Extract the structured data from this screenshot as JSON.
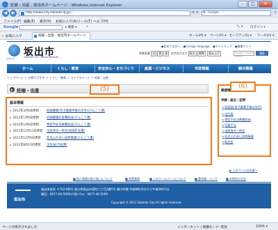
{
  "window": {
    "title": "妊娠・出産 - 坂出市ホームページ - Windows Internet Explorer",
    "minimize": "–",
    "maximize": "□",
    "close": "✕"
  },
  "address": {
    "url": "http://www.city.sakaide.lg.jp/…",
    "search_placeholder": "Google",
    "search_engine": "G"
  },
  "menu": [
    "ファイル(F)",
    "編集(E)",
    "表示(V)",
    "お気に入り(A)",
    "ツール(T)",
    "ヘルプ(H)"
  ],
  "google_toolbar": {
    "logo": "Google",
    "go": "検索",
    "buttons": [
      "▸ 検索 ▾",
      "»",
      "🔧 ▾"
    ],
    "signin": "ログイン ▾"
  },
  "favorites": {
    "label": "お気に入り",
    "item": "妊娠・出産 - 坂出市ホームページ",
    "tools": [
      "ホーム(M) ▾",
      "ページ(P) ▾",
      "セーフティ(S) ▾",
      "ツール(O) ▾"
    ]
  },
  "site": {
    "name": "坂出市",
    "sub": "Sakaide City Official Website",
    "tag": "さかいで",
    "util_links": [
      "●初めての方へ",
      "●Foreign language",
      "●サイトマップ",
      "●携帯サイト"
    ],
    "util_row2_label": "背景変更",
    "util_row2_buttons": [
      "白",
      "黒",
      "青"
    ],
    "text_size_label": "文字の大きさ",
    "text_size_buttons": [
      "拡大",
      "標準"
    ],
    "read_label": "読み上げ",
    "search_placeholder": "Google Custom Search",
    "search_button": "検索",
    "gnav": [
      "ホーム",
      "くらし・教育",
      "安全安心・まちづくり",
      "産業・ビジネス",
      "市政情報",
      "観光情報"
    ],
    "breadcrumb": "トップページ ＞ 分野でさがす ＞ くらし・教育 ＞ ライフステージ ＞ 妊娠・出産",
    "page_title": "妊娠・出産"
  },
  "annotations": {
    "box5": "(5)",
    "box6": "(6)"
  },
  "info": {
    "heading": "基本情報",
    "rows": [
      {
        "date": "2012年3月6日更新",
        "link": "妊婦健康(母子健康手帳の交付)",
        "dept": "(けんこう課)"
      },
      {
        "date": "2012年1月6日更新",
        "link": "妊婦健康診査費助成",
        "dept": "(けんこう課)"
      },
      {
        "date": "2012年1月6日更新",
        "link": "特定不妊治療費助成",
        "dept": "(けんこう課)"
      },
      {
        "date": "2011年12月13日更新",
        "link": "出産育児一時金",
        "dept": "(保険年金課)"
      },
      {
        "date": "2011年12月6日更新",
        "link": "乳児ふれあい訪問事業",
        "dept": "(けんこう課)"
      },
      {
        "date": "2011年8月10日更新",
        "link": "出生届",
        "dept": "(市民課)"
      }
    ]
  },
  "side": {
    "heading": "関連情報",
    "category": "申請・届出・証明",
    "items": [
      "妊娠届(母子健康手帳の交付)",
      "出生届",
      "特定不妊治療費助成",
      "児童手当",
      "出産育児一時金",
      "乳児ふれあい訪問事業",
      "助成金"
    ],
    "more": "▶ このページの先頭へ"
  },
  "footer": {
    "links": [
      "■ 個人情報の取り扱いについて",
      "■ 免責事項",
      "■ このホームページについて",
      "■ 著作権・リンク",
      "■ お問合わせ先"
    ],
    "name": "坂出市",
    "addr1": "坂出市役所 〒762-8601 香川県坂出市室町二丁目3番5号 開庁時間 午前8時30分から午後5時15分",
    "addr2": "電話：0877-46-5000(代表)  Fax：0877-46-5000",
    "copyright": "Copyright © 2011 Sakaide City All rights reserved."
  },
  "status": {
    "left": "ページが表示されました",
    "zone": "インターネット | 保護モード: 有効",
    "zoom": "100% ▾"
  }
}
